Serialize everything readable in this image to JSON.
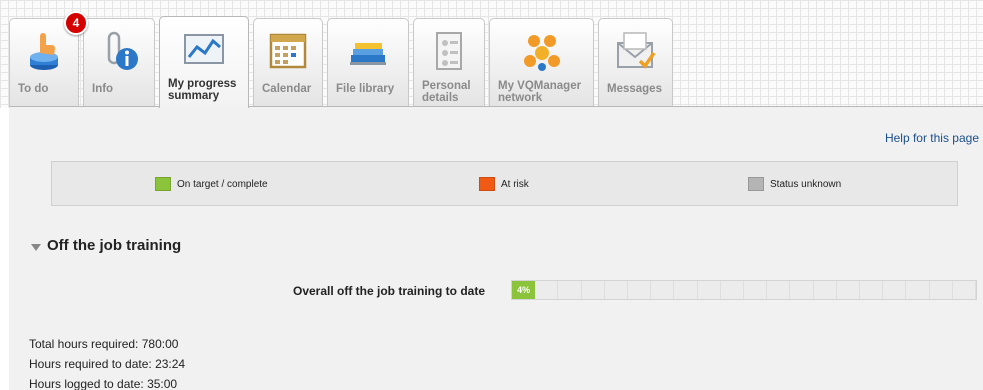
{
  "badge": {
    "count": "4"
  },
  "tabs": [
    {
      "label": "To do",
      "icon": "todo-hand-icon"
    },
    {
      "label": "Info",
      "icon": "info-icon"
    },
    {
      "label": "My progress\nsummary",
      "icon": "progress-chart-icon",
      "active": true
    },
    {
      "label": "Calendar",
      "icon": "calendar-icon"
    },
    {
      "label": "File library",
      "icon": "file-library-icon"
    },
    {
      "label": "Personal\ndetails",
      "icon": "personal-details-icon"
    },
    {
      "label": "My VQManager\nnetwork",
      "icon": "network-people-icon"
    },
    {
      "label": "Messages",
      "icon": "messages-envelope-icon"
    }
  ],
  "help": {
    "label": "Help for this page"
  },
  "legend": {
    "on_target": {
      "label": "On target / complete",
      "color": "#8bc33a"
    },
    "at_risk": {
      "label": "At risk",
      "color": "#f05a14"
    },
    "unknown": {
      "label": "Status unknown",
      "color": "#b4b4b4"
    }
  },
  "section": {
    "title": "Off the job training"
  },
  "progress": {
    "label": "Overall off the job training to date",
    "value_text": "4%",
    "value_fraction": 0.04
  },
  "stats": {
    "total_hours": "Total hours required: 780:00",
    "required_to_date": "Hours required to date: 23:24",
    "logged_to_date": "Hours logged to date: 35:00"
  }
}
